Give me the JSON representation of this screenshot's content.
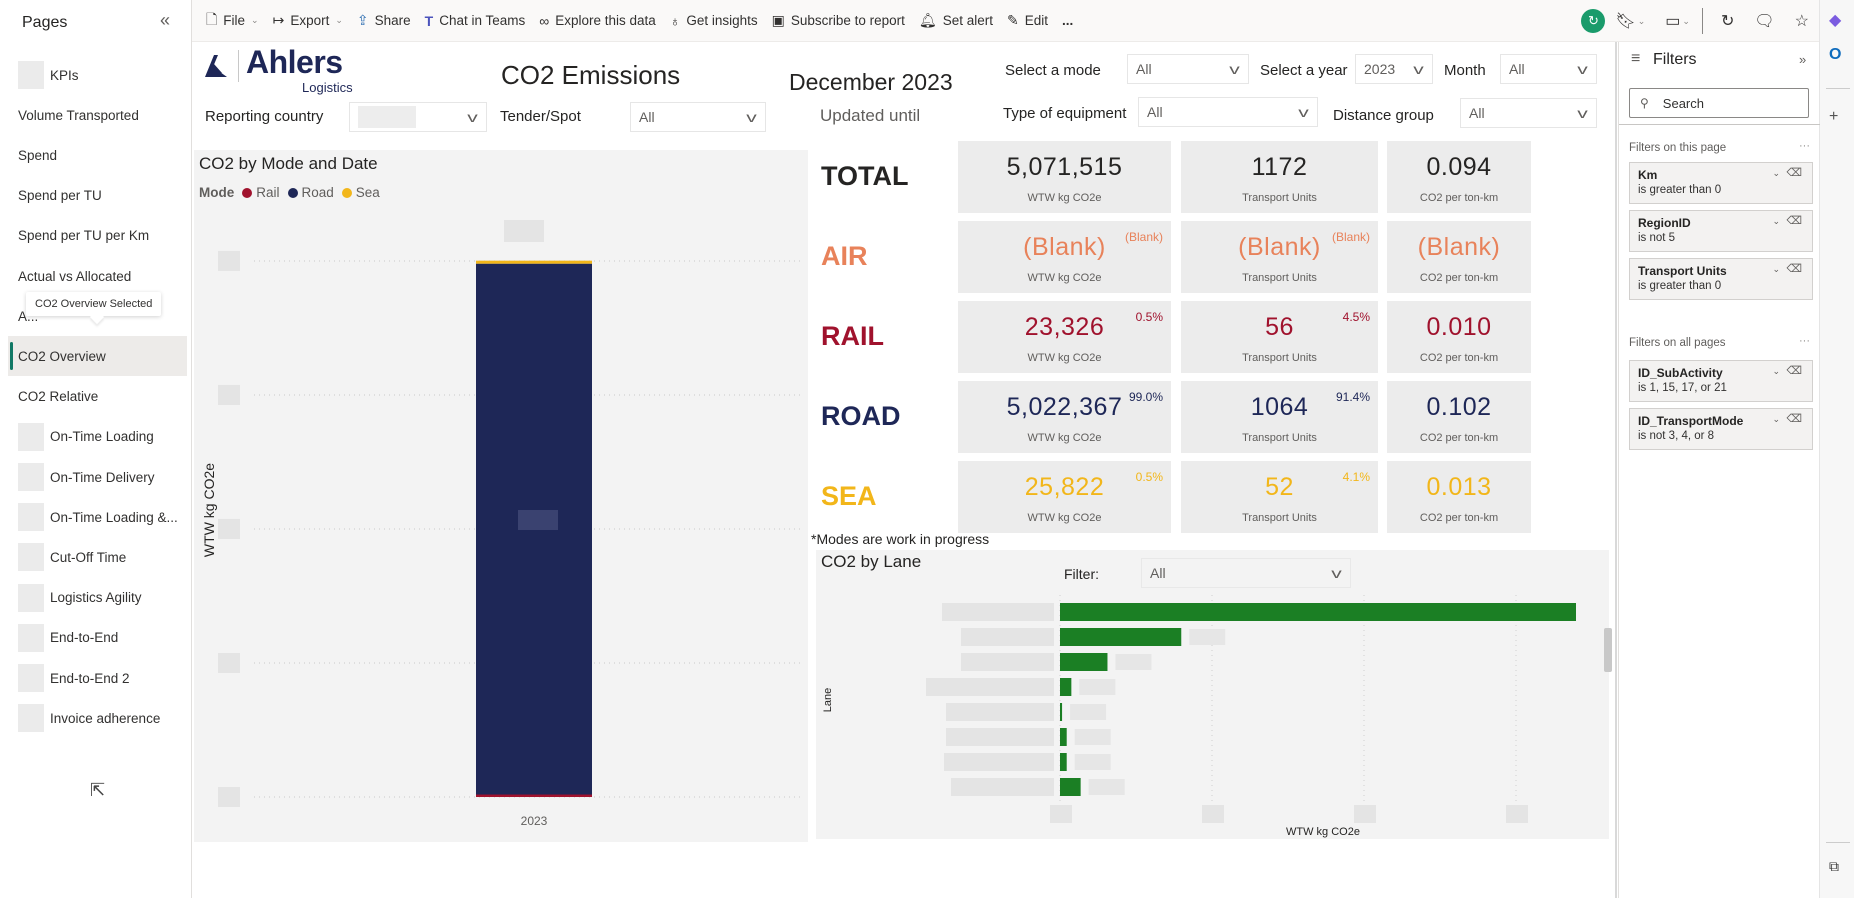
{
  "pages_pane": {
    "title": "Pages",
    "collapse_icon": "double-chevron-left-icon",
    "tooltip": "CO2 Overview Selected",
    "items": [
      {
        "label": "KPIs",
        "blurred_prefix": true
      },
      {
        "label": "Volume Transported",
        "blurred_prefix": false
      },
      {
        "label": "Spend",
        "blurred_prefix": false
      },
      {
        "label": "Spend per TU",
        "blurred_prefix": false
      },
      {
        "label": "Spend per TU per Km",
        "blurred_prefix": false
      },
      {
        "label": "Actual vs Allocated",
        "blurred_prefix": false
      },
      {
        "label": "A...",
        "blurred_prefix": false
      },
      {
        "label": "CO2 Overview",
        "blurred_prefix": false,
        "active": true
      },
      {
        "label": "CO2 Relative",
        "blurred_prefix": false
      },
      {
        "label": "On-Time Loading",
        "blurred_prefix": true
      },
      {
        "label": "On-Time Delivery",
        "blurred_prefix": true
      },
      {
        "label": "On-Time Loading &...",
        "blurred_prefix": true
      },
      {
        "label": "Cut-Off Time",
        "blurred_prefix": true
      },
      {
        "label": "Logistics Agility",
        "blurred_prefix": true
      },
      {
        "label": "End-to-End",
        "blurred_prefix": true
      },
      {
        "label": "End-to-End 2",
        "blurred_prefix": true
      },
      {
        "label": "Invoice adherence",
        "blurred_prefix": true
      }
    ]
  },
  "toolbar": {
    "items": [
      {
        "label": "File",
        "icon": "file-icon",
        "dropdown": true
      },
      {
        "label": "Export",
        "icon": "export-icon",
        "dropdown": true
      },
      {
        "label": "Share",
        "icon": "share-icon"
      },
      {
        "label": "Chat in Teams",
        "icon": "teams-icon"
      },
      {
        "label": "Explore this data",
        "icon": "binoculars-icon"
      },
      {
        "label": "Get insights",
        "icon": "lightbulb-icon"
      },
      {
        "label": "Subscribe to report",
        "icon": "subscribe-icon"
      },
      {
        "label": "Set alert",
        "icon": "bell-icon"
      },
      {
        "label": "Edit",
        "icon": "pencil-icon"
      },
      {
        "label": "...",
        "icon": "more-icon"
      }
    ],
    "right_icons": [
      "refresh-status-icon",
      "bookmark-icon",
      "view-icon",
      "reload-icon",
      "comment-icon",
      "favorite-icon"
    ]
  },
  "header": {
    "logo_name": "Ahlers",
    "logo_sub": "Logistics",
    "title": "CO2 Emissions",
    "period": "December 2023",
    "updated_label": "Updated until",
    "slicers": {
      "reporting_country": {
        "label": "Reporting country",
        "value": ""
      },
      "tender_spot": {
        "label": "Tender/Spot",
        "value": "All"
      },
      "mode": {
        "label": "Select a mode",
        "value": "All"
      },
      "year": {
        "label": "Select a year",
        "value": "2023"
      },
      "month": {
        "label": "Month",
        "value": "All"
      },
      "equipment": {
        "label": "Type of equipment",
        "value": "All"
      },
      "distance": {
        "label": "Distance group",
        "value": "All"
      }
    }
  },
  "colors": {
    "rail": "#a0122d",
    "road": "#1e2757",
    "sea": "#f2b61a",
    "air": "#e8825a",
    "total": "#252423",
    "lane_bar": "#1b7f24",
    "accent_active": "#117865"
  },
  "kpi": {
    "rows": [
      {
        "mode": "TOTAL",
        "key": "total",
        "co2": "5,071,515",
        "co2_pct": "",
        "tu": "1172",
        "tu_pct": "",
        "intensity": "0.094"
      },
      {
        "mode": "AIR",
        "key": "air",
        "co2": "(Blank)",
        "co2_pct": "(Blank)",
        "tu": "(Blank)",
        "tu_pct": "(Blank)",
        "intensity": "(Blank)"
      },
      {
        "mode": "RAIL",
        "key": "rail",
        "co2": "23,326",
        "co2_pct": "0.5%",
        "tu": "56",
        "tu_pct": "4.5%",
        "intensity": "0.010"
      },
      {
        "mode": "ROAD",
        "key": "road",
        "co2": "5,022,367",
        "co2_pct": "99.0%",
        "tu": "1064",
        "tu_pct": "91.4%",
        "intensity": "0.102"
      },
      {
        "mode": "SEA",
        "key": "sea",
        "co2": "25,822",
        "co2_pct": "0.5%",
        "tu": "52",
        "tu_pct": "4.1%",
        "intensity": "0.013"
      }
    ],
    "sublabels": {
      "co2": "WTW kg CO2e",
      "tu": "Transport Units",
      "intensity": "CO2 per ton-km"
    },
    "note": "*Modes are work in progress"
  },
  "chart_data": [
    {
      "type": "bar",
      "stacked": true,
      "title": "CO2 by Mode and Date",
      "legend_title": "Mode",
      "legend": [
        "Rail",
        "Road",
        "Sea"
      ],
      "legend_placement": "top-left",
      "categories": [
        "2023"
      ],
      "series": [
        {
          "name": "Rail",
          "values": [
            23326
          ]
        },
        {
          "name": "Road",
          "values": [
            5022367
          ]
        },
        {
          "name": "Sea",
          "values": [
            25822
          ]
        }
      ],
      "xlabel": "",
      "ylabel": "WTW kg CO2e",
      "ylim": [
        0,
        5071515
      ],
      "grid": true,
      "tick_labels_redacted": true
    },
    {
      "type": "bar",
      "orientation": "horizontal",
      "title": "CO2 by Lane",
      "filter_label": "Filter:",
      "filter_value": "All",
      "xlabel": "WTW kg CO2e",
      "ylabel": "Lane",
      "categories_redacted": true,
      "relative_values": [
        1.0,
        0.235,
        0.092,
        0.022,
        0.004,
        0.013,
        0.013,
        0.04
      ],
      "grid": true
    }
  ],
  "filters_pane": {
    "title": "Filters",
    "search_placeholder": "Search",
    "on_this_page_label": "Filters on this page",
    "on_all_pages_label": "Filters on all pages",
    "page_filters": [
      {
        "field": "Km",
        "condition": "is greater than 0"
      },
      {
        "field": "RegionID",
        "condition": "is not 5"
      },
      {
        "field": "Transport Units",
        "condition": "is greater than 0"
      }
    ],
    "all_page_filters": [
      {
        "field": "ID_SubActivity",
        "condition": "is 1, 15, 17, or 21"
      },
      {
        "field": "ID_TransportMode",
        "condition": "is not 3, 4, or 8"
      }
    ]
  }
}
